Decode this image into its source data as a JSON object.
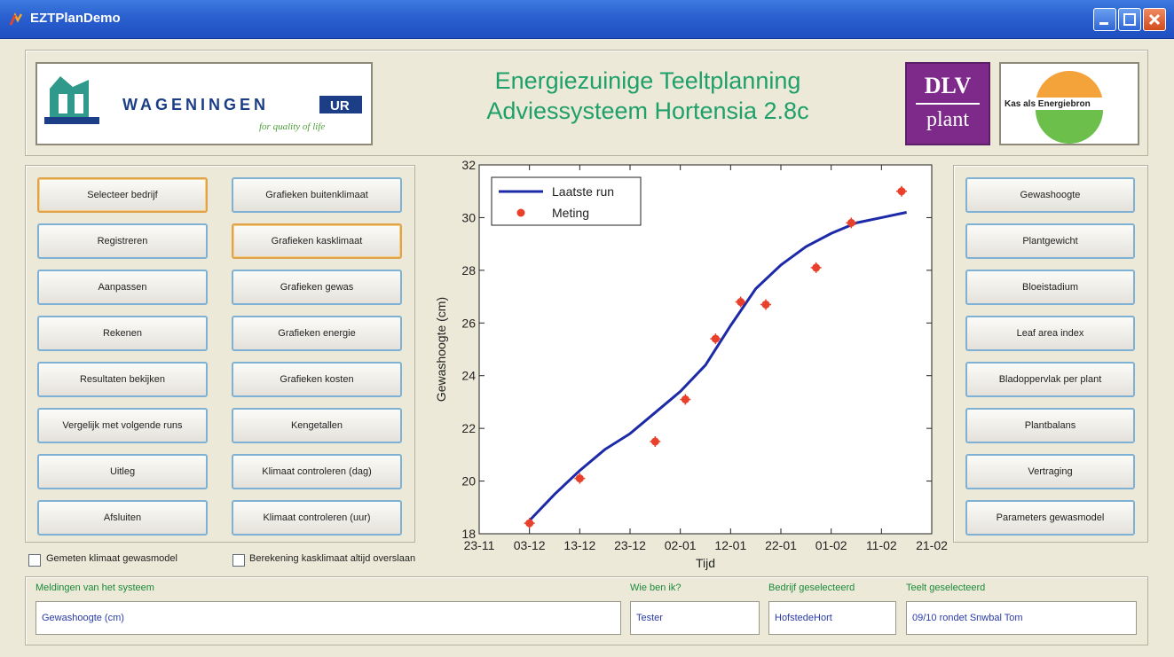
{
  "window": {
    "title": "EZTPlanDemo",
    "controls": {
      "minimize_icon": "minimize-icon",
      "maximize_icon": "maximize-icon",
      "close_icon": "close-icon"
    }
  },
  "header": {
    "title_line1": "Energiezuinige Teeltplanning",
    "title_line2": "Adviessysteem Hortensia 2.8c",
    "logo_wur": {
      "wordmark": "WAGENINGEN",
      "badge": "UR",
      "tagline": "for quality of life"
    },
    "logo_dlv": {
      "line1": "DLV",
      "line2": "plant"
    },
    "logo_kas": {
      "text": "Kas als Energiebron"
    }
  },
  "left_buttons": {
    "col1": [
      "Selecteer bedrijf",
      "Registreren",
      "Aanpassen",
      "Rekenen",
      "Resultaten bekijken",
      "Vergelijk met volgende runs",
      "Uitleg",
      "Afsluiten"
    ],
    "col2": [
      "Grafieken buitenklimaat",
      "Grafieken kasklimaat",
      "Grafieken gewas",
      "Grafieken energie",
      "Grafieken kosten",
      "Kengetallen",
      "Klimaat controleren (dag)",
      "Klimaat controleren (uur)"
    ]
  },
  "right_buttons": [
    "Gewashoogte",
    "Plantgewicht",
    "Bloeistadium",
    "Leaf area index",
    "Bladoppervlak per plant",
    "Plantbalans",
    "Vertraging",
    "Parameters gewasmodel"
  ],
  "checkboxes": {
    "c1": {
      "label": "Gemeten klimaat gewasmodel",
      "checked": false
    },
    "c2": {
      "label": "Berekening kasklimaat altijd overslaan",
      "checked": false
    }
  },
  "status": {
    "messages_label": "Meldingen van het systeem",
    "messages_value": "Gewashoogte (cm)",
    "who_label": "Wie ben ik?",
    "who_value": "Tester",
    "company_label": "Bedrijf geselecteerd",
    "company_value": "HofstedeHort",
    "crop_label": "Teelt geselecteerd",
    "crop_value": "09/10 rondet Snwbal Tom"
  },
  "chart_data": {
    "type": "line",
    "xlabel": "Tijd",
    "ylabel": "Gewashoogte (cm)",
    "ylim": [
      18,
      32
    ],
    "yticks": [
      18,
      20,
      22,
      24,
      26,
      28,
      30,
      32
    ],
    "xtick_labels": [
      "23-11",
      "03-12",
      "13-12",
      "23-12",
      "02-01",
      "12-01",
      "22-01",
      "01-02",
      "11-02",
      "21-02"
    ],
    "xlim": [
      0,
      90
    ],
    "legend_position": "top-left",
    "series": [
      {
        "name": "Laatste run",
        "style": "line",
        "color": "#1c2aa8",
        "x": [
          10,
          15,
          20,
          25,
          30,
          35,
          40,
          45,
          50,
          55,
          60,
          65,
          70,
          75,
          80,
          85
        ],
        "y": [
          18.5,
          19.5,
          20.4,
          21.2,
          21.8,
          22.6,
          23.4,
          24.4,
          25.9,
          27.3,
          28.2,
          28.9,
          29.4,
          29.8,
          30.0,
          30.2
        ]
      },
      {
        "name": "Meting",
        "style": "markers",
        "color": "#e8402a",
        "x": [
          10,
          20,
          35,
          41,
          47,
          52,
          57,
          67,
          74,
          84
        ],
        "y": [
          18.4,
          20.1,
          21.5,
          23.1,
          25.4,
          26.8,
          26.7,
          28.1,
          29.8,
          31.0
        ]
      }
    ]
  }
}
